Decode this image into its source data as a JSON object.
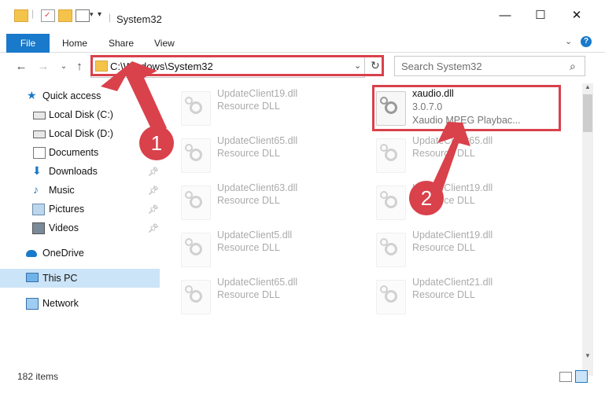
{
  "window": {
    "title": "System32",
    "controls": {
      "minimize": "—",
      "maximize": "☐",
      "close": "✕"
    }
  },
  "ribbon": {
    "tabs": [
      "File",
      "Home",
      "Share",
      "View"
    ]
  },
  "address": {
    "path": "C:\\Windows\\System32"
  },
  "search": {
    "placeholder": "Search System32"
  },
  "sidebar": {
    "items": [
      {
        "label": "Quick access",
        "icon": "star-icon"
      },
      {
        "label": "Local Disk (C:)",
        "icon": "drive-icon"
      },
      {
        "label": "Local Disk (D:)",
        "icon": "drive-icon"
      },
      {
        "label": "Documents",
        "icon": "documents-icon"
      },
      {
        "label": "Downloads",
        "icon": "download-icon"
      },
      {
        "label": "Music",
        "icon": "music-icon"
      },
      {
        "label": "Pictures",
        "icon": "pictures-icon"
      },
      {
        "label": "Videos",
        "icon": "videos-icon"
      },
      {
        "label": "OneDrive",
        "icon": "cloud-icon"
      },
      {
        "label": "This PC",
        "icon": "computer-icon"
      },
      {
        "label": "Network",
        "icon": "network-icon"
      }
    ]
  },
  "files": {
    "left_column": [
      {
        "name": "UpdateClient19.dll",
        "type": "Resource DLL"
      },
      {
        "name": "UpdateClient65.dll",
        "type": "Resource DLL"
      },
      {
        "name": "UpdateClient63.dll",
        "type": "Resource DLL"
      },
      {
        "name": "UpdateClient5.dll",
        "type": "Resource DLL"
      },
      {
        "name": "UpdateClient65.dll",
        "type": "Resource DLL"
      }
    ],
    "right_column": [
      {
        "name": "xaudio.dll",
        "version": "3.0.7.0",
        "type": "Xaudio MPEG Playbac..."
      },
      {
        "name": "UpdateClient65.dll",
        "type": "Resource DLL"
      },
      {
        "name": "UpdateClient19.dll",
        "type": "Resource DLL"
      },
      {
        "name": "UpdateClient19.dll",
        "type": "Resource DLL"
      },
      {
        "name": "UpdateClient21.dll",
        "type": "Resource DLL"
      }
    ]
  },
  "status": {
    "item_count": "182 items"
  },
  "markers": [
    "1",
    "2"
  ],
  "colors": {
    "accent": "#1979ca",
    "highlight": "#d9414b",
    "selected": "#cce4f7"
  }
}
